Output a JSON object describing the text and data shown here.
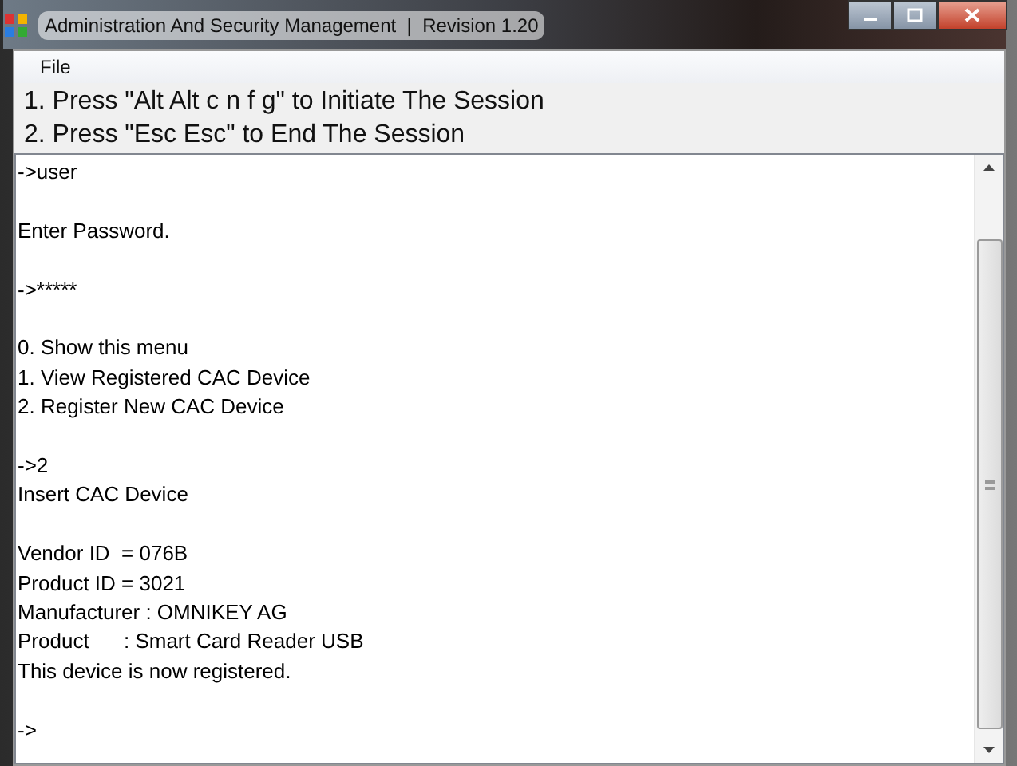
{
  "window": {
    "title": "Administration And Security Management  |  Revision 1.20"
  },
  "menu": [
    "File"
  ],
  "instructions": [
    "1. Press \"Alt Alt c n f g\" to Initiate The Session",
    "2. Press \"Esc Esc\" to End The Session"
  ],
  "console": [
    {
      "kind": "text",
      "text": "->user"
    },
    {
      "kind": "blank"
    },
    {
      "kind": "text",
      "text": "Enter Password."
    },
    {
      "kind": "blank"
    },
    {
      "kind": "text",
      "text": "->*****"
    },
    {
      "kind": "blank"
    },
    {
      "kind": "text",
      "text": "0. Show this menu"
    },
    {
      "kind": "text",
      "text": "1. View Registered CAC Device"
    },
    {
      "kind": "text",
      "text": "2. Register New CAC Device"
    },
    {
      "kind": "blank"
    },
    {
      "kind": "text",
      "text": "->2"
    },
    {
      "kind": "text",
      "text": "Insert CAC Device"
    },
    {
      "kind": "blank"
    },
    {
      "kind": "text",
      "text": "Vendor ID  = 076B"
    },
    {
      "kind": "text",
      "text": "Product ID = 3021"
    },
    {
      "kind": "text",
      "text": "Manufacturer : OMNIKEY AG"
    },
    {
      "kind": "text",
      "text": "Product      : Smart Card Reader USB"
    },
    {
      "kind": "text",
      "text": "This device is now registered."
    },
    {
      "kind": "blank"
    },
    {
      "kind": "text",
      "text": "->"
    }
  ]
}
